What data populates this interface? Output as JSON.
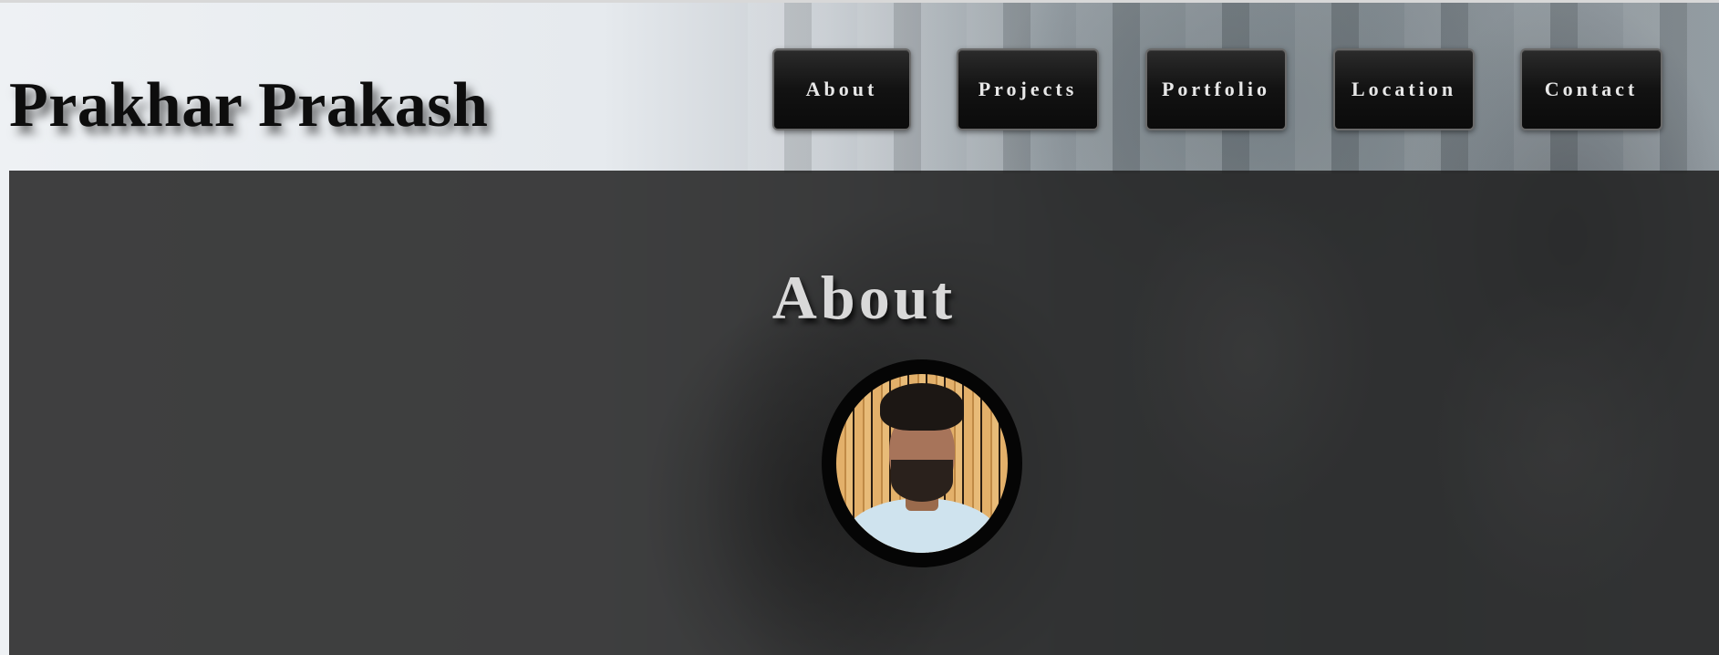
{
  "header": {
    "brand": "Prakhar Prakash"
  },
  "nav": {
    "items": [
      {
        "label": "About"
      },
      {
        "label": "Projects"
      },
      {
        "label": "Portfolio"
      },
      {
        "label": "Location"
      },
      {
        "label": "Contact"
      }
    ]
  },
  "about": {
    "title": "About",
    "avatar_alt": "profile-photo"
  }
}
